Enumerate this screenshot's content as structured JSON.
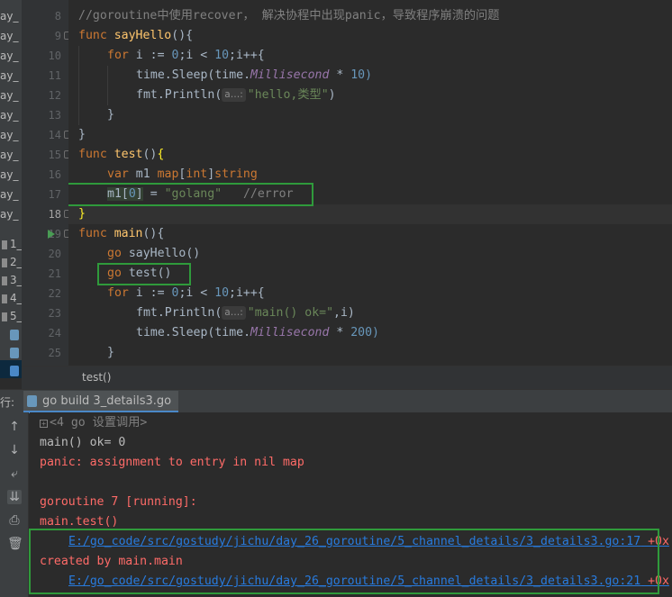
{
  "file_tree": {
    "items": [
      "ay_",
      "ay_",
      "ay_",
      "ay_",
      "ay_",
      "ay_",
      "ay_",
      "ay_",
      "ay_",
      "ay_",
      "ay_",
      "1_",
      "2_",
      "3_",
      "4_",
      "5_"
    ]
  },
  "editor": {
    "line_numbers": [
      "8",
      "9",
      "10",
      "11",
      "12",
      "13",
      "14",
      "15",
      "16",
      "17",
      "18",
      "19",
      "20",
      "21",
      "22",
      "23",
      "24",
      "25"
    ],
    "current_line": "18",
    "hint_label": "a…:",
    "comment_line8": "//goroutine中使用recover， 解决协程中出现panic，导致程序崩溃的问题",
    "tokens": {
      "func": "func",
      "for": "for",
      "var": "var",
      "go": "go",
      "i": "i",
      "assign": " := ",
      "zero": "0",
      "semi_i": ";i < ",
      "ten": "10",
      "iplus": ";i++{",
      "sayHello": "sayHello",
      "test": "test",
      "main": "main",
      "parens_open": "(){",
      "close_brace": "}",
      "time_sleep": "time.Sleep(time.",
      "millisecond": "Millisecond",
      "times": " * ",
      "ten_close": "10)",
      "two_hundred_close": "200)",
      "fmt_println": "fmt.Println(",
      "hello_str": "\"hello,类型\"",
      "close_paren": ")",
      "m1_decl": " m1 ",
      "map_kw": "map",
      "int_kw": "int",
      "string_kw": "string",
      "m1": "m1",
      "idx0": "0",
      "eq": " = ",
      "golang_str": "\"golang\"",
      "error_comment": "//error",
      "go_test": " test()",
      "go_sayhello": " sayHello()",
      "main_ok_str": "\"main() ok=\"",
      "comma_i": ",i)"
    }
  },
  "breadcrumb": {
    "text": "test()"
  },
  "run_panel": {
    "label": "行:",
    "tab_title": "go build 3_details3.go"
  },
  "console": {
    "folded": "<4 go 设置调用>",
    "lines": [
      "main() ok= 0",
      "panic: assignment to entry in nil map",
      "",
      "goroutine 7 [running]:",
      "main.test()"
    ],
    "link1": "E:/go_code/src/gostudy/jichu/day_26_goroutine/5_channel_details/3_details3.go:17",
    "link1_tail": " +0x",
    "created_by": "created by main.main",
    "link2": "E:/go_code/src/gostudy/jichu/day_26_goroutine/5_channel_details/3_details3.go:21",
    "link2_tail": " +0x"
  },
  "colors": {
    "highlight_box": "#2f9a3b",
    "link": "#287bde",
    "error": "#ff6b68"
  }
}
